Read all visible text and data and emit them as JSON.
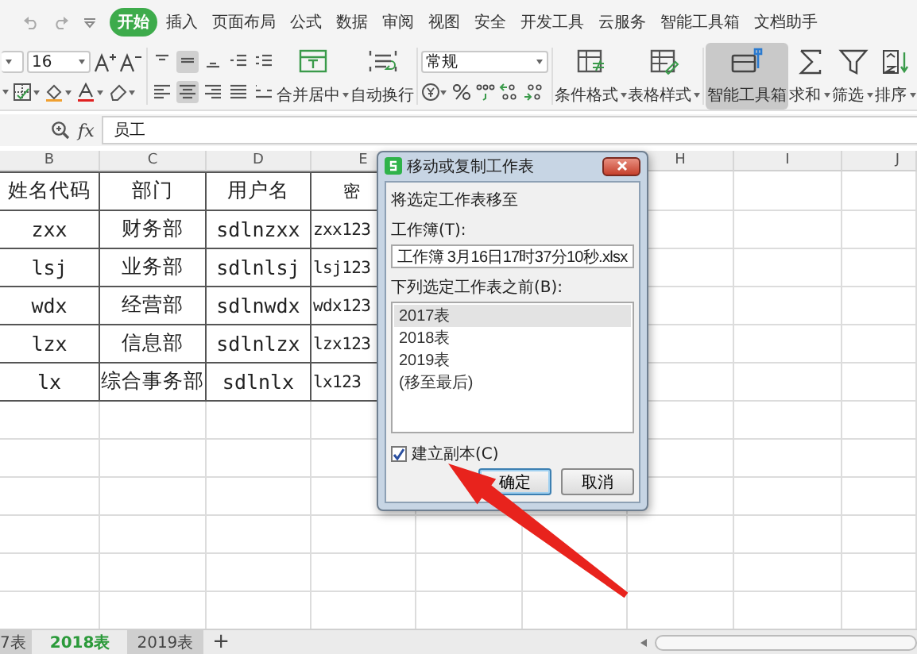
{
  "menu_tabs": [
    {
      "label": "开始",
      "selected": true
    },
    {
      "label": "插入",
      "selected": false
    },
    {
      "label": "页面布局",
      "selected": false
    },
    {
      "label": "公式",
      "selected": false
    },
    {
      "label": "数据",
      "selected": false
    },
    {
      "label": "审阅",
      "selected": false
    },
    {
      "label": "视图",
      "selected": false
    },
    {
      "label": "安全",
      "selected": false
    },
    {
      "label": "开发工具",
      "selected": false
    },
    {
      "label": "云服务",
      "selected": false
    },
    {
      "label": "智能工具箱",
      "selected": false
    },
    {
      "label": "文档助手",
      "selected": false
    }
  ],
  "ribbon": {
    "font_size": "16",
    "number_format": "常规",
    "align_buttons": [
      {
        "pressed": false
      },
      {
        "pressed": true
      },
      {
        "pressed": false
      },
      {
        "pressed": false
      },
      {
        "pressed": false
      },
      {
        "pressed": false
      },
      {
        "pressed": true
      },
      {
        "pressed": false
      },
      {
        "pressed": false
      },
      {
        "pressed": false
      }
    ],
    "big_buttons": [
      {
        "label": "合并居中",
        "dropdown": true,
        "pressed": false
      },
      {
        "label": "自动换行",
        "dropdown": false,
        "pressed": false
      },
      {
        "label": "条件格式",
        "dropdown": true,
        "pressed": false
      },
      {
        "label": "表格样式",
        "dropdown": true,
        "pressed": false
      },
      {
        "label": "智能工具箱",
        "dropdown": false,
        "pressed": true
      },
      {
        "label": "求和",
        "dropdown": true,
        "pressed": false
      },
      {
        "label": "筛选",
        "dropdown": true,
        "pressed": false
      },
      {
        "label": "排序",
        "dropdown": true,
        "pressed": false
      }
    ]
  },
  "formula_bar": {
    "fx": "fx",
    "value": "员工"
  },
  "grid": {
    "column_headers": [
      "B",
      "C",
      "D",
      "E",
      "H",
      "I",
      "J"
    ],
    "rows": [
      [
        "姓名代码",
        "部门",
        "用户名",
        "密"
      ],
      [
        "zxx",
        "财务部",
        "sdlnzxx",
        "zxx123"
      ],
      [
        "lsj",
        "业务部",
        "sdlnlsj",
        "lsj123"
      ],
      [
        "wdx",
        "经营部",
        "sdlnwdx",
        "wdx123"
      ],
      [
        "lzx",
        "信息部",
        "sdlnlzx",
        "lzx123"
      ],
      [
        "lx",
        "综合事务部",
        "sdlnlx",
        "lx123"
      ]
    ]
  },
  "dialog": {
    "title": "移动或复制工作表",
    "intro": "将选定工作表移至",
    "workbook_label": "工作簿(T):",
    "workbook": "工作簿 3月16日17时37分10秒.xlsx",
    "before_label": "下列选定工作表之前(B):",
    "sheets": [
      {
        "label": "2017表",
        "selected": true
      },
      {
        "label": "2018表",
        "selected": false
      },
      {
        "label": "2019表",
        "selected": false
      },
      {
        "label": "(移至最后)",
        "selected": false
      }
    ],
    "copy": {
      "label": "建立副本(C)",
      "checked": true
    },
    "buttons": [
      "确定",
      "取消"
    ]
  },
  "sheet_tabs": [
    {
      "label": "7表",
      "selected": false
    },
    {
      "label": "2018表",
      "selected": true
    },
    {
      "label": "2019表",
      "selected": false
    }
  ],
  "add_sheet": "+"
}
